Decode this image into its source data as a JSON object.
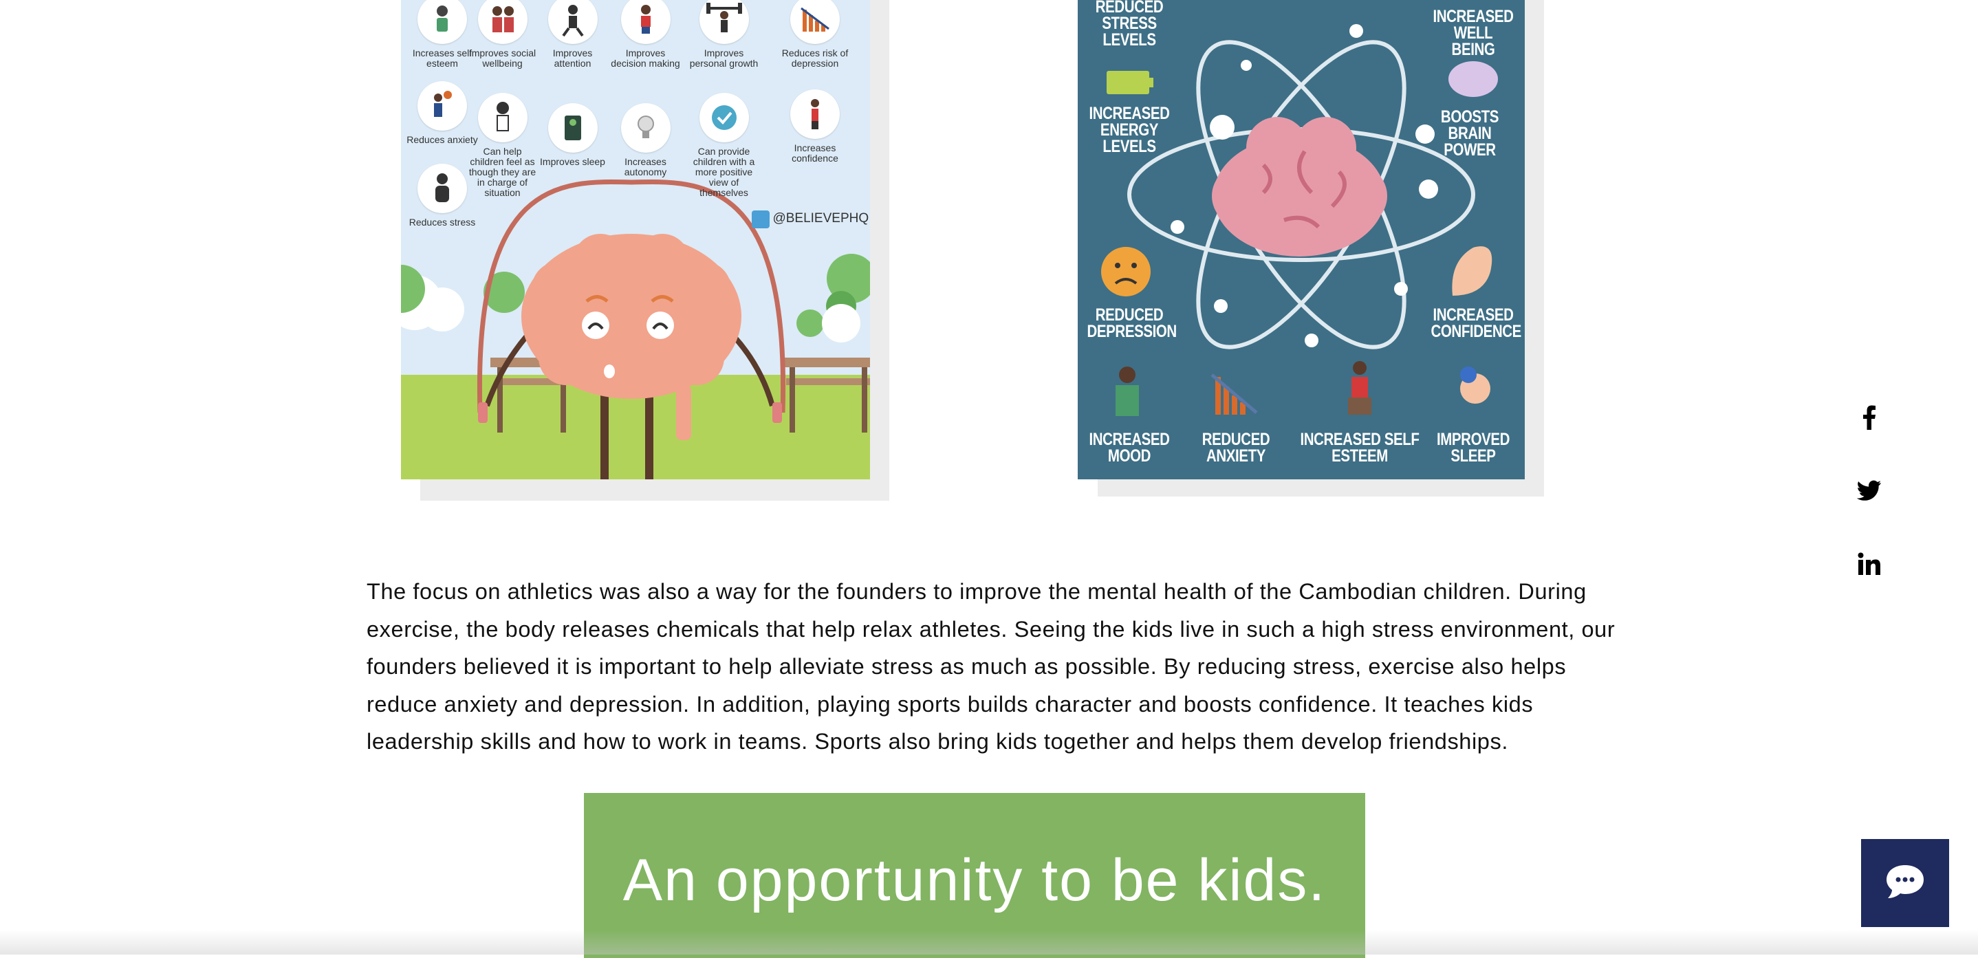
{
  "left_infographic": {
    "benefits": [
      {
        "label": "Increases self esteem",
        "icon": "person-exercising-icon"
      },
      {
        "label": "Improves social wellbeing",
        "icon": "people-together-icon"
      },
      {
        "label": "Improves attention",
        "icon": "runner-icon"
      },
      {
        "label": "Improves decision making",
        "icon": "soccer-player-icon"
      },
      {
        "label": "Improves personal growth",
        "icon": "weightlifter-icon"
      },
      {
        "label": "Reduces risk of depression",
        "icon": "declining-chart-icon"
      },
      {
        "label": "Reduces anxiety",
        "icon": "basketball-player-icon"
      },
      {
        "label": "Can help children feel as though they are in charge of situation",
        "icon": "child-icon"
      },
      {
        "label": "Improves sleep",
        "icon": "sleeping-icon"
      },
      {
        "label": "Increases autonomy",
        "icon": "lightbulb-icon"
      },
      {
        "label": "Can provide children with a more positive view of themselves",
        "icon": "checkmark-icon"
      },
      {
        "label": "Increases confidence",
        "icon": "confident-person-icon"
      },
      {
        "label": "Reduces stress",
        "icon": "relaxed-person-icon"
      }
    ],
    "handle": "@BELIEVEPHQ"
  },
  "right_infographic": {
    "labels": {
      "reduced_stress": "REDUCED\nSTRESS\nLEVELS",
      "increased_wellbeing": "INCREASED\nWELL BEING",
      "increased_energy": "INCREASED\nENERGY\nLEVELS",
      "boosts_brain": "BOOSTS\nBRAIN\nPOWER",
      "reduced_depression": "REDUCED\nDEPRESSION",
      "increased_confidence": "INCREASED\nCONFIDENCE",
      "increased_mood": "INCREASED\nMOOD",
      "reduced_anxiety": "REDUCED\nANXIETY",
      "increased_self_esteem": "INCREASED SELF\nESTEEM",
      "improved_sleep": "IMPROVED\nSLEEP"
    },
    "colors": {
      "background": "#3e6f86",
      "brain": "#e69aa8"
    }
  },
  "article": {
    "paragraph": "The focus on athletics was also a way for the founders to improve the mental health of the Cambodian children. During exercise, the body releases chemicals that help relax athletes. Seeing the kids live in such a high stress environment, our founders believed it is important to help alleviate stress as much as possible. By reducing stress, exercise also helps reduce anxiety and depression. In addition, playing sports builds character and boosts confidence. It teaches kids leadership skills and how to work in teams. Sports also bring kids together and helps them develop friendships."
  },
  "banner": {
    "text": "An opportunity to be kids.",
    "color": "#82b462"
  },
  "share_bar": {
    "icons": [
      "facebook-icon",
      "twitter-icon",
      "linkedin-icon"
    ]
  },
  "chat_widget": {
    "color": "#1f2a5e",
    "icon": "chat-bubble-icon"
  }
}
